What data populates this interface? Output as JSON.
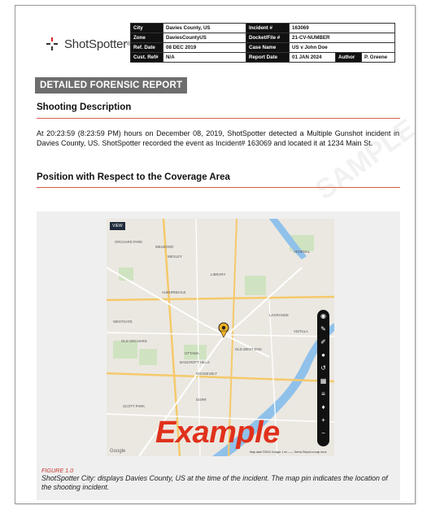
{
  "logo": {
    "name": "ShotSpotter",
    "tm": "®"
  },
  "meta": {
    "rows": [
      [
        "City",
        "Davies County, US",
        "Incident #",
        "163069",
        "",
        ""
      ],
      [
        "Zone",
        "DaviesCountyUS",
        "Docket/File #",
        "21-CV-NUMBER",
        "",
        ""
      ],
      [
        "Ref. Date",
        "08 DEC 2019",
        "Case Name",
        "US v John Doe",
        "",
        ""
      ],
      [
        "Cust. Ref#",
        "N/A",
        "Report Date",
        "01 JAN 2024",
        "Author",
        "P. Greene"
      ]
    ]
  },
  "banner": "DETAILED FORENSIC REPORT",
  "section1": {
    "title": "Shooting Description",
    "body": "At 20:23:59 (8:23:59 PM) hours on December 08, 2019, ShotSpotter detected a Multiple Gunshot incident in Davies County, US. ShotSpotter recorded the event as Incident# 163069 and located it at 1234 Main St."
  },
  "section2": {
    "title": "Position with Respect to the Coverage Area"
  },
  "figure": {
    "view_badge": "VIEW",
    "watermark": "Example",
    "label": "FIGURE 1.0",
    "caption": "ShotSpotter City: displays Davies County, US at the time of the incident. The map pin indicates the location of the shooting incident.",
    "google": "Google",
    "credit": "Map data ©2024 Google  1 mi ——  Terms  Report a map error",
    "map_labels": [
      "MELWOOD",
      "WEXLEY",
      "ORCHARD PARK",
      "LIBRARY",
      "AUBURNDALE",
      "WESTGATE",
      "OLD ORCHARD",
      "OTTAWA",
      "BANCROFT HILLS",
      "OLD WEST END",
      "ROOSEVELT",
      "VISTULA",
      "SCOTT PARK",
      "DORR",
      "LAGRANGE",
      "ARSENAL"
    ]
  }
}
